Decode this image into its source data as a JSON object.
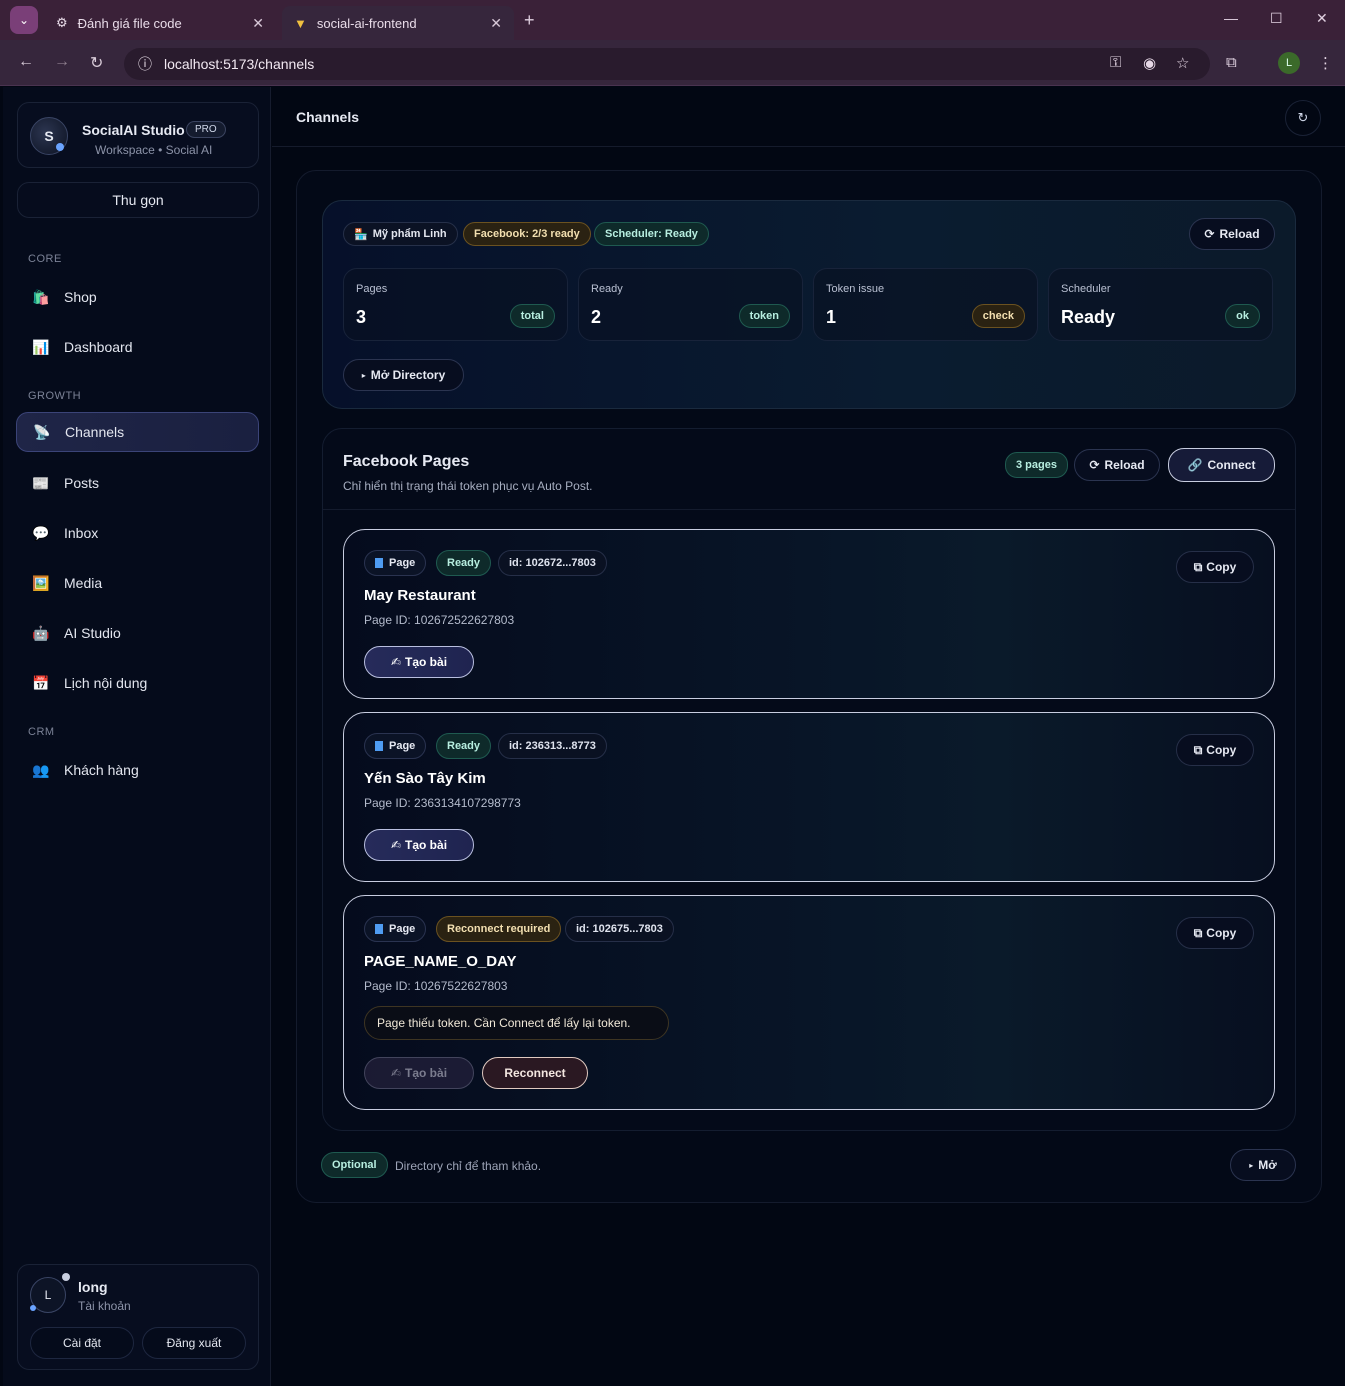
{
  "browser": {
    "tabs": [
      {
        "title": "Đánh giá file code",
        "icon": "openai-icon"
      },
      {
        "title": "social-ai-frontend",
        "icon": "vite-icon"
      }
    ],
    "url": "localhost:5173/channels",
    "profile_initial": "L"
  },
  "sidebar": {
    "brand_name": "SocialAI Studio",
    "brand_badge": "PRO",
    "brand_sub": "Workspace • Social AI",
    "brand_initial": "S",
    "collapse_label": "Thu gọn",
    "sections": {
      "core": "CORE",
      "growth": "GROWTH",
      "crm": "CRM"
    },
    "items": [
      {
        "label": "Shop",
        "icon": "🛍️"
      },
      {
        "label": "Dashboard",
        "icon": "📊"
      },
      {
        "label": "Channels",
        "icon": "📡"
      },
      {
        "label": "Posts",
        "icon": "📰"
      },
      {
        "label": "Inbox",
        "icon": "💬"
      },
      {
        "label": "Media",
        "icon": "🖼️"
      },
      {
        "label": "AI Studio",
        "icon": "🤖"
      },
      {
        "label": "Lịch nội dung",
        "icon": "📅"
      },
      {
        "label": "Khách hàng",
        "icon": "👥"
      }
    ],
    "user": {
      "initial": "L",
      "name": "long",
      "sub": "Tài khoản",
      "settings_label": "Cài đặt",
      "logout_label": "Đăng xuất"
    }
  },
  "header": {
    "title": "Channels"
  },
  "summary": {
    "shop_pill": "Mỹ phẩm Linh",
    "facebook_pill": "Facebook: 2/3 ready",
    "scheduler_pill": "Scheduler: Ready",
    "reload_label": "Reload",
    "stats": [
      {
        "label": "Pages",
        "value": "3",
        "badge": "total"
      },
      {
        "label": "Ready",
        "value": "2",
        "badge": "token"
      },
      {
        "label": "Token issue",
        "value": "1",
        "badge": "check"
      },
      {
        "label": "Scheduler",
        "value": "Ready",
        "badge": "ok"
      }
    ],
    "directory_label": "Mở Directory"
  },
  "facebook": {
    "title": "Facebook Pages",
    "subtitle": "Chỉ hiển thị trạng thái token phục vụ Auto Post.",
    "count_pill": "3 pages",
    "reload_label": "Reload",
    "connect_label": "Connect",
    "pages": [
      {
        "type": "Page",
        "status": "Ready",
        "id_short": "id: 102672...7803",
        "name": "May Restaurant",
        "page_id": "Page ID: 102672522627803",
        "copy_label": "Copy",
        "create_label": "Tạo bài"
      },
      {
        "type": "Page",
        "status": "Ready",
        "id_short": "id: 236313...8773",
        "name": "Yến Sào Tây Kim",
        "page_id": "Page ID: 2363134107298773",
        "copy_label": "Copy",
        "create_label": "Tạo bài"
      },
      {
        "type": "Page",
        "status": "Reconnect required",
        "id_short": "id: 102675...7803",
        "name": "PAGE_NAME_O_DAY",
        "page_id": "Page ID: 10267522627803",
        "copy_label": "Copy",
        "create_label": "Tạo bài",
        "warning": "Page thiếu token. Cần Connect để lấy lại token.",
        "reconnect_label": "Reconnect"
      }
    ]
  },
  "optional": {
    "pill": "Optional",
    "text": "Directory chỉ để tham khảo.",
    "open_label": "Mở"
  },
  "colors": {
    "accent_teal": "#b7eee0",
    "accent_amber": "#f2dfb0",
    "background": "#020713"
  }
}
